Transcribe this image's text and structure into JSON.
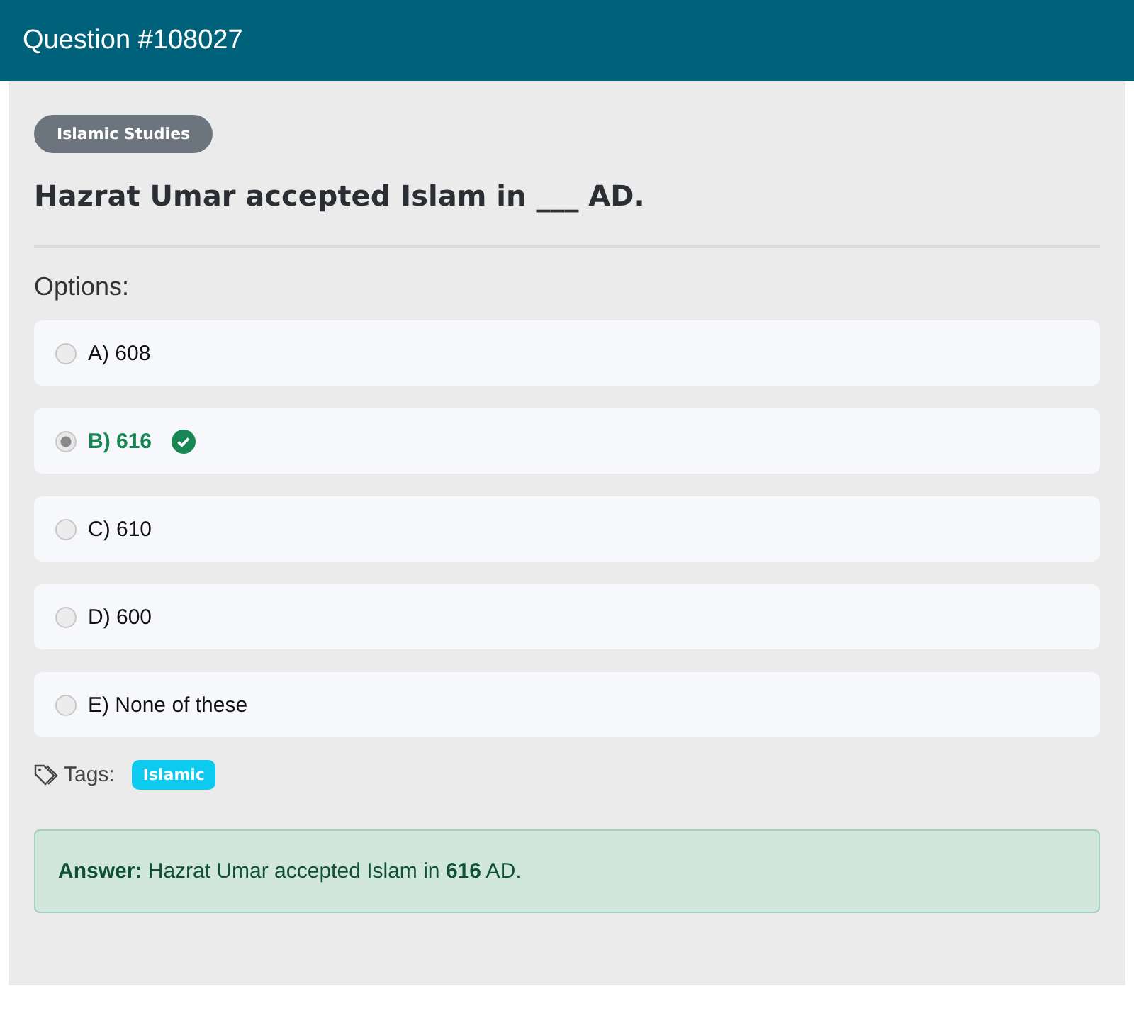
{
  "header": {
    "title": "Question #108027"
  },
  "category": "Islamic Studies",
  "question": "Hazrat Umar accepted Islam in ___ AD.",
  "options_label": "Options:",
  "options": [
    {
      "label": "A) 608",
      "selected": false,
      "correct": false
    },
    {
      "label": "B) 616",
      "selected": true,
      "correct": true
    },
    {
      "label": "C) 610",
      "selected": false,
      "correct": false
    },
    {
      "label": "D) 600",
      "selected": false,
      "correct": false
    },
    {
      "label": "E) None of these",
      "selected": false,
      "correct": false
    }
  ],
  "tags_label": "Tags:",
  "tags": [
    "Islamic"
  ],
  "answer": "**Answer:** Hazrat Umar accepted Islam in **616** AD."
}
